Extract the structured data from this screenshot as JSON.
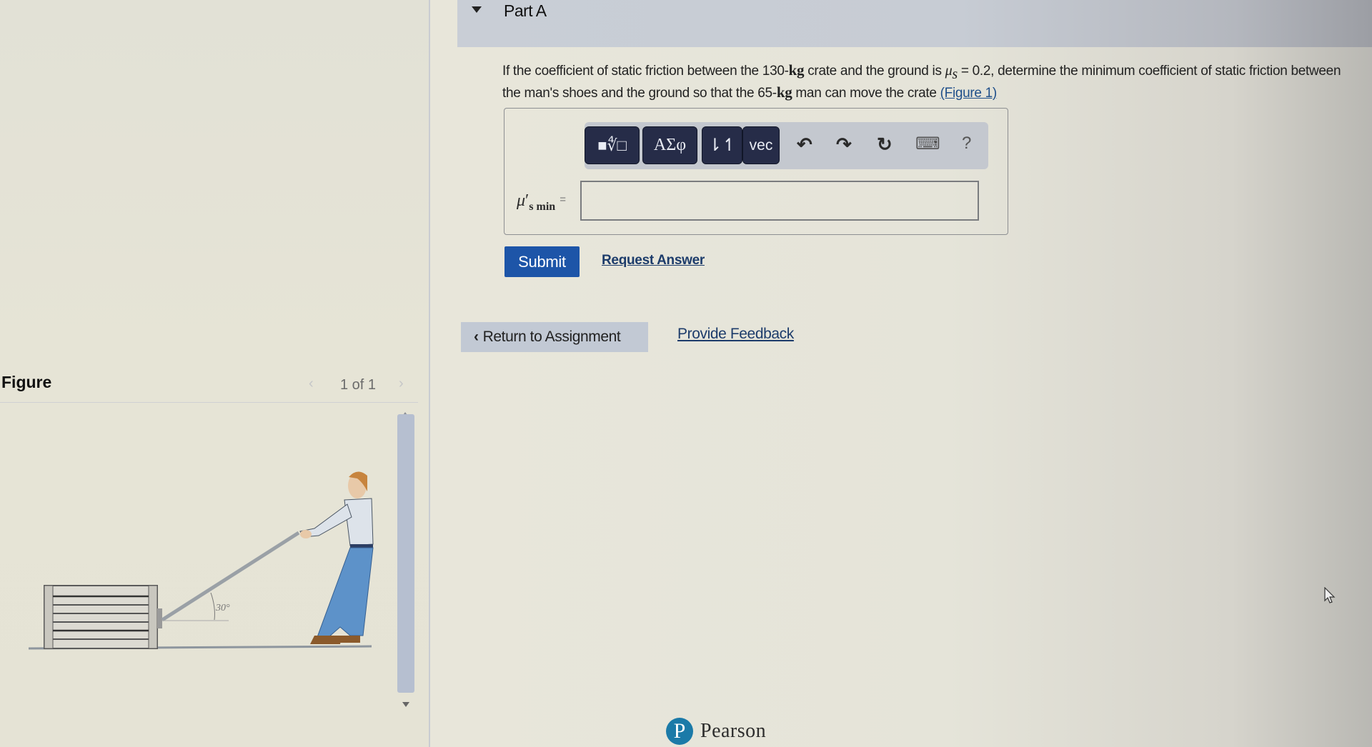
{
  "part": {
    "title": "Part A",
    "collapse_icon": "caret-down-icon"
  },
  "question": {
    "text_1": "If the coefficient of static friction between the 130-",
    "unit_1": "kg",
    "text_2": " crate and the ground is ",
    "mu_symbol": "μ",
    "mu_sub": "s",
    "text_3": " = 0.2, determine the minimum coefficient of static friction between the man's shoes and the ground so that the 65-",
    "unit_2": "kg",
    "text_4": " man can move the crate ",
    "figure_link": "(Figure 1)"
  },
  "toolbar": {
    "buttons": [
      {
        "name": "templates-button",
        "label": "■∜□",
        "icon": "fraction-root-template-icon"
      },
      {
        "name": "symbols-button",
        "label": "ΑΣφ",
        "icon": "greek-symbols-icon"
      },
      {
        "name": "arrows-button",
        "label": "⇂↿",
        "icon": "subscript-superscript-icon"
      },
      {
        "name": "vector-button",
        "label": "vec",
        "icon": "vector-icon"
      }
    ],
    "undo_icon": "↶",
    "redo_icon": "↷",
    "reset_icon": "↻",
    "keyboard_icon": "⌨",
    "help_icon": "?"
  },
  "answer": {
    "variable": "μ",
    "prime": "′",
    "subscript": "s min",
    "equals": "=",
    "value": ""
  },
  "actions": {
    "submit_label": "Submit",
    "request_answer_label": "Request Answer",
    "return_label": "Return to Assignment",
    "return_icon": "‹",
    "feedback_label": "Provide Feedback"
  },
  "figure": {
    "title": "Figure",
    "page_indicator": "1 of 1",
    "prev_icon": "‹",
    "next_icon": "›",
    "angle_label": "30°"
  },
  "footer": {
    "brand": "Pearson",
    "logo_letter": "P"
  },
  "colors": {
    "submit_bg": "#1d55a8",
    "toolbar_btn_bg": "#262c48",
    "link": "#1d3c6b",
    "pearson_blue": "#1b7aa8"
  }
}
